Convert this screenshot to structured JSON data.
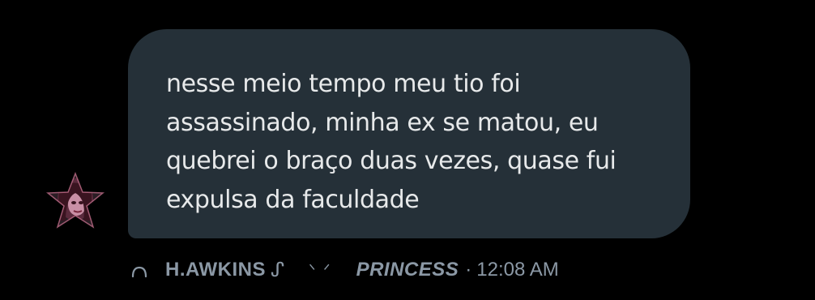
{
  "message": {
    "lines": [
      "nesse meio tempo meu tio foi",
      "assassinado, minha ex se matou, eu",
      "quebrei o braço duas vezes, quase fui",
      "expulsa da faculdade"
    ],
    "sender": {
      "name": "H.AWKINS",
      "deco": "ᔑ",
      "accent": "ᐠ ᐟ",
      "title": "PRINCESS"
    },
    "separator": "·",
    "time": "12:08 AM"
  },
  "colors": {
    "background": "#000000",
    "bubble": "#253038",
    "text": "#e7e9ea",
    "meta": "#8b98a5"
  },
  "icons": {
    "avatar": "star-shaped-profile-avatar",
    "reply": "reply-arc-icon"
  }
}
